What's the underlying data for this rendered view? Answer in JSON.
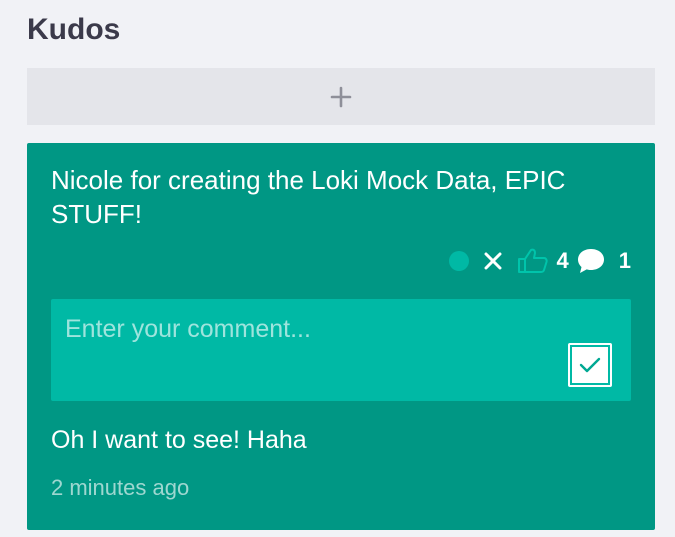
{
  "column": {
    "title": "Kudos",
    "add_icon": "plus-icon"
  },
  "card": {
    "message": "Nicole for creating the Loki Mock Data, EPIC STUFF!",
    "actions": {
      "status_icon": "dot-icon",
      "delete_icon": "close-icon",
      "like_icon": "thumbs-up-icon",
      "like_count": "4",
      "comment_icon": "speech-bubble-icon",
      "comment_count": "1"
    },
    "comment_form": {
      "placeholder": "Enter your comment...",
      "value": "",
      "submit_icon": "checkmark-icon"
    },
    "comments": [
      {
        "text": "Oh I want to see! Haha",
        "time": "2 minutes ago"
      }
    ]
  },
  "colors": {
    "page_background": "#f1f2f6",
    "card_background": "#009784",
    "comment_box_background": "#00b9a5",
    "accent_teal": "#00b9a5",
    "title_text": "#3b3a4a",
    "add_button_background": "#e4e5ea"
  }
}
